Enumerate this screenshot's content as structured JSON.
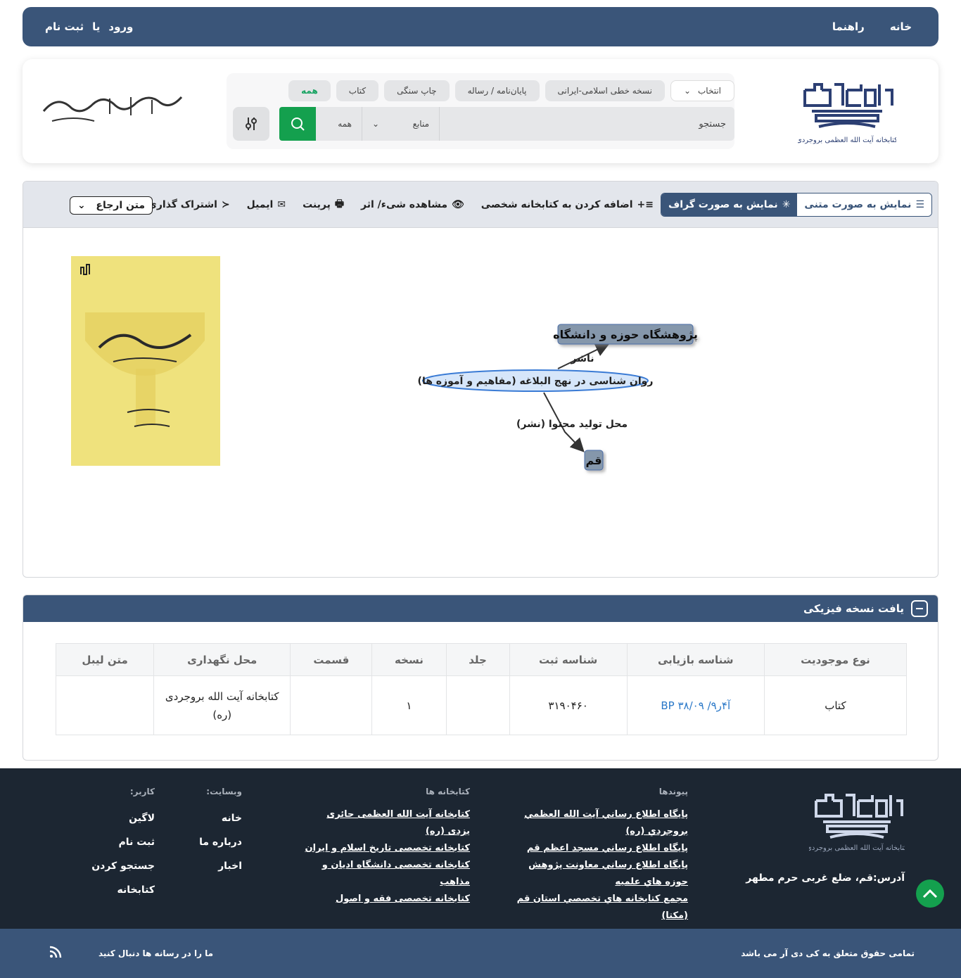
{
  "nav": {
    "home": "خانه",
    "guide": "راهنما",
    "login": "ورود",
    "or": "یا",
    "register": "ثبت نام"
  },
  "header": {
    "logo_right_caption": "کتابخانه آیت الله العظمی بروجردی",
    "filter_chips": [
      "نسخه خطی اسلامی-ایرانی",
      "پایان‌نامه / رساله",
      "چاپ سنگی",
      "کتاب",
      "همه"
    ],
    "select_label": "انتخاب",
    "search_placeholder": "جستجو",
    "sources_label": "منابع",
    "all_label": "همه"
  },
  "toolbar": {
    "view_text": "نمایش به صورت متنی",
    "view_graph": "نمایش به صورت گراف",
    "add_personal": "اضافه کردن به کتابخانه شخصی",
    "view_object": "مشاهده شیء/ اثر",
    "print": "پرینت",
    "email": "ایمیل",
    "share": "اشتراک گذاری",
    "ref_select": "متن ارجاع"
  },
  "graph": {
    "center": "روان شناسی در نهج البلاغه (مفاهیم و آموزه ها)",
    "publisher_node": "پژوهشگاه حوزه و دانشگاه",
    "publisher_edge": "ناشر",
    "place_edge": "محل تولید محتوا (نشر)",
    "place_node": "قم"
  },
  "holdings": {
    "title": "یافت نسخه فیزیکی",
    "headers": [
      "نوع موجودیت",
      "شناسه بازیابی",
      "شناسه ثبت",
      "جلد",
      "نسخه",
      "قسمت",
      "محل نگهداری",
      "متن لیبل"
    ],
    "row": {
      "type": "کتاب",
      "call_number": "BP ۳۸/۰۹ /۹آ۴ر",
      "reg_id": "۳۱۹۰۴۶۰",
      "volume": "",
      "copy": "۱",
      "part": "",
      "location": "کتابخانه آیت الله بروجردی (ره)",
      "label": ""
    }
  },
  "footer": {
    "links_title": "پیوندها",
    "links": [
      "پايگاه اطلاع رساني آيت الله العظمي بروجردي (ره)",
      "پايگاه اطلاع رساني مسجد اعظم قم",
      "پايگاه اطلاع رساني معاونت پژوهش حوزه هاي علميه",
      "مجمع كتابخانه هاي تخصصي استان قم (مكتا)"
    ],
    "libraries_title": "کتابخانه ها",
    "libraries": [
      "کتابخانه آیت الله العظمی حائری یزدی (ره)",
      "کتابخانه تخصصی تاریخ اسلام و ایران",
      "کتابخانه تخصصی دانشگاه ادیان و مذاهب",
      "کتابخانه تخصصی فقه و اصول"
    ],
    "website_title": "وبسایت:",
    "website": [
      "خانه",
      "درباره ما",
      "اخبار"
    ],
    "user_title": "کاربر:",
    "user": [
      "لاگین",
      "ثبت نام",
      "جستجو کردن",
      "کتابخانه"
    ],
    "address": "آدرس:قم، ضلع غربی حرم مطهر",
    "copyright": "تمامی حقوق متعلق به کی دی آر می باشد",
    "follow": "ما را در رسانه ها دنبال کنید"
  }
}
